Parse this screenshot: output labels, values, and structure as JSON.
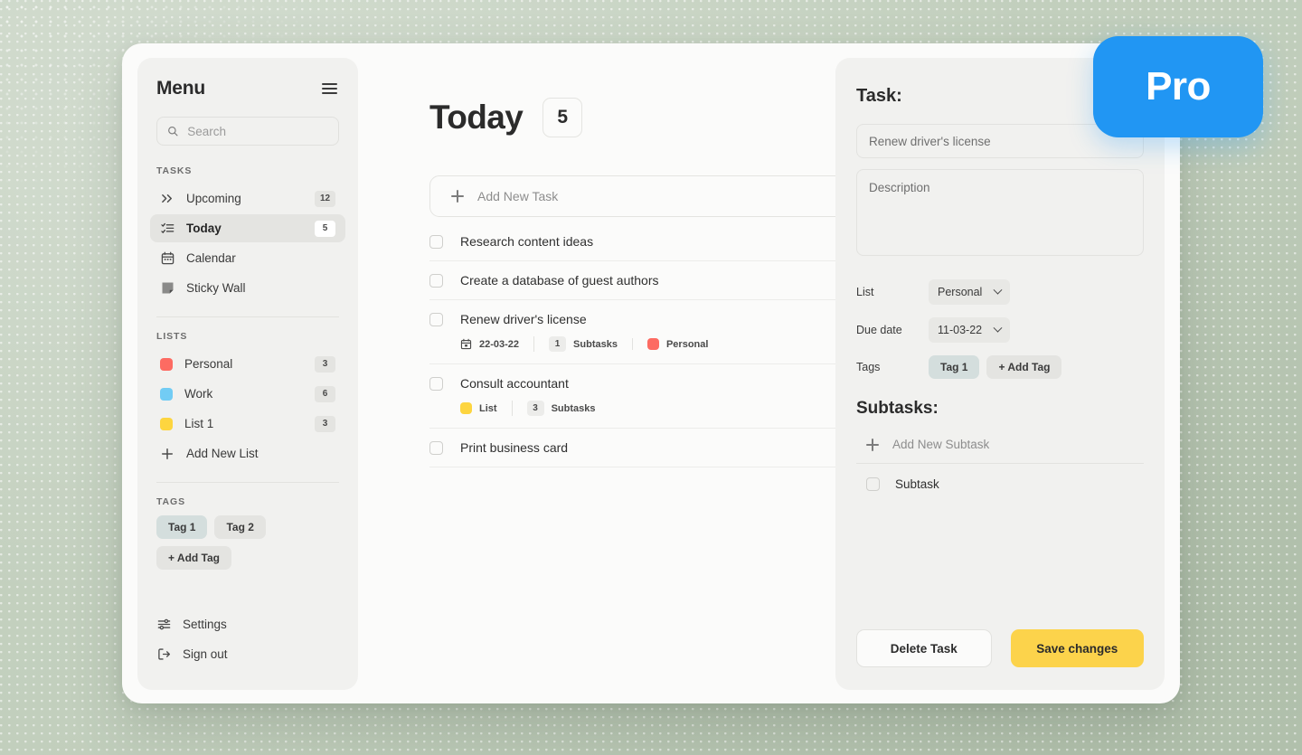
{
  "sidebar": {
    "title": "Menu",
    "menu_icon": "hamburger-icon",
    "search": {
      "placeholder": "Search",
      "value": "",
      "icon": "search-icon"
    },
    "tasks_label": "TASKS",
    "tasks": [
      {
        "label": "Upcoming",
        "count": "12",
        "icon": "chevrons-right-icon",
        "active": false
      },
      {
        "label": "Today",
        "count": "5",
        "icon": "list-check-icon",
        "active": true
      },
      {
        "label": "Calendar",
        "count": "",
        "icon": "calendar-icon",
        "active": false
      },
      {
        "label": "Sticky Wall",
        "count": "",
        "icon": "sticky-note-icon",
        "active": false
      }
    ],
    "lists_label": "LISTS",
    "lists": [
      {
        "label": "Personal",
        "count": "3",
        "color": "#fd6b62"
      },
      {
        "label": "Work",
        "count": "6",
        "color": "#72ccf4"
      },
      {
        "label": "List 1",
        "count": "3",
        "color": "#fdd53f"
      }
    ],
    "add_list_label": "Add New List",
    "tags_label": "TAGS",
    "tags": [
      {
        "label": "Tag 1",
        "selected": true
      },
      {
        "label": "Tag 2",
        "selected": false
      },
      {
        "label": "+ Add Tag",
        "selected": false
      }
    ],
    "footer": [
      {
        "label": "Settings",
        "icon": "sliders-icon"
      },
      {
        "label": "Sign out",
        "icon": "sign-out-icon"
      }
    ]
  },
  "main": {
    "title": "Today",
    "count": "5",
    "add_task_label": "Add New Task",
    "tasks": [
      {
        "name": "Research content ideas",
        "meta": []
      },
      {
        "name": "Create a database of guest authors",
        "meta": []
      },
      {
        "name": "Renew driver's license",
        "meta": [
          {
            "type": "date",
            "text": "22-03-22",
            "icon": "calendar-icon"
          },
          {
            "type": "subtasks",
            "count": "1",
            "text": "Subtasks"
          },
          {
            "type": "list",
            "text": "Personal",
            "color": "#fd6b62"
          }
        ]
      },
      {
        "name": "Consult accountant",
        "meta": [
          {
            "type": "list",
            "text": "List",
            "color": "#fdd53f"
          },
          {
            "type": "subtasks",
            "count": "3",
            "text": "Subtasks"
          }
        ]
      },
      {
        "name": "Print business card",
        "meta": []
      }
    ]
  },
  "detail": {
    "title": "Task:",
    "task_name_placeholder": "Renew driver's license",
    "task_name_value": "",
    "description_placeholder": "Description",
    "description_value": "",
    "list_label": "List",
    "list_value": "Personal",
    "due_date_label": "Due date",
    "due_date_value": "11-03-22",
    "tags_label": "Tags",
    "tags": [
      {
        "label": "Tag 1",
        "selected": true
      },
      {
        "label": "+ Add Tag",
        "selected": false
      }
    ],
    "subtasks_title": "Subtasks:",
    "add_subtask_label": "Add New Subtask",
    "subtasks": [
      {
        "label": "Subtask"
      }
    ],
    "delete_label": "Delete Task",
    "save_label": "Save changes"
  },
  "pro_badge": {
    "label": "Pro",
    "color": "#2196f3"
  }
}
